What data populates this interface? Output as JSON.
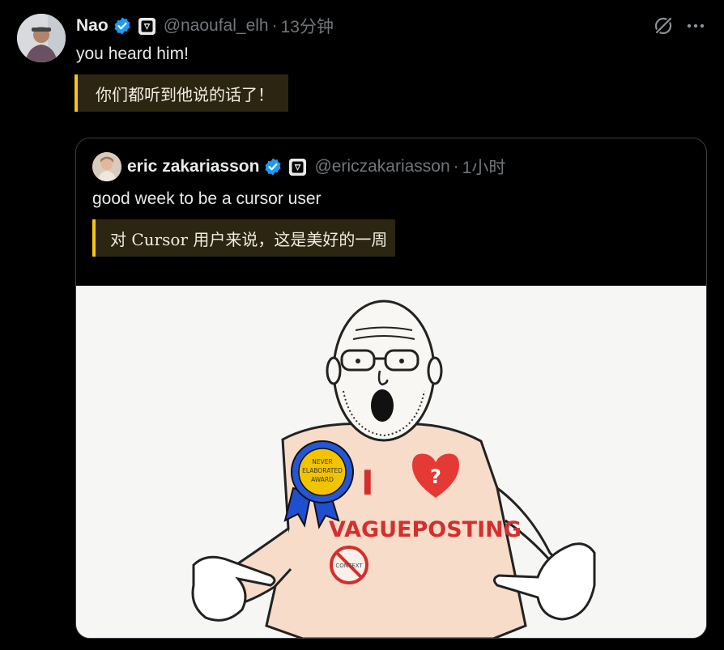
{
  "tweet": {
    "display_name": "Nao",
    "handle": "@naoufal_elh",
    "separator": "·",
    "time": "13分钟",
    "text": "you heard him!",
    "translation": "你们都听到他说的话了！",
    "avatar_icon": "avatar-photo",
    "verified_color": "#1d9bf0"
  },
  "quoted": {
    "display_name": "eric zakariasson",
    "handle": "@ericzakariasson",
    "separator": "·",
    "time": "1小时",
    "text": "good week to be a cursor user",
    "translation": "对 Cursor 用户来说，这是美好的一周"
  },
  "media": {
    "badge_lines": [
      "NEVER",
      "ELABORATED",
      "AWARD"
    ],
    "shirt_i": "I",
    "shirt_question": "?",
    "shirt_word": "VAGUEPOSTING",
    "no_sign_text": "CONTEXT"
  },
  "colors": {
    "accent_yellow": "#f5c518",
    "translation_bg": "#2b2511",
    "muted": "#71767b"
  }
}
